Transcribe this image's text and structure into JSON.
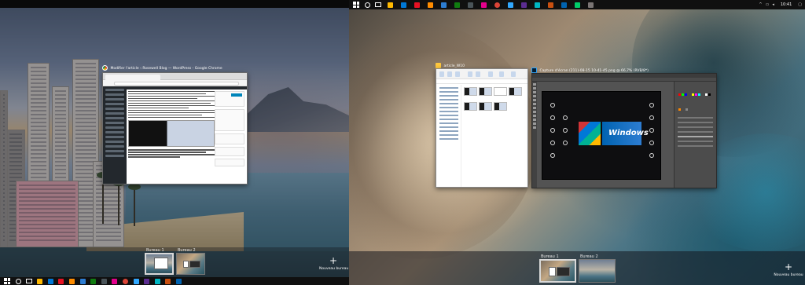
{
  "left_monitor": {
    "window": {
      "title": "Modifier l'article ‹ Rosewell Blog — WordPress - Google Chrome"
    },
    "task_view": {
      "desktops": [
        {
          "label": "Bureau 1",
          "active": true
        },
        {
          "label": "Bureau 2",
          "active": false
        }
      ],
      "new_desktop_label": "Nouveau bureau"
    }
  },
  "right_monitor": {
    "windows": [
      {
        "title": "article_W10",
        "icon": "folder-icon"
      },
      {
        "title": "Capture d'écran (211)-08-15 10-41-45.png @ 66,7% (RVB/8*)",
        "icon": "photoshop-icon"
      }
    ],
    "task_view": {
      "desktops": [
        {
          "label": "Bureau 1",
          "active": true
        },
        {
          "label": "Bureau 2",
          "active": false
        }
      ],
      "new_desktop_label": "Nouveau bureau"
    },
    "taskbar": {
      "time": "10:41"
    },
    "canvas_logo": "Windows"
  },
  "taskbar_icon_colors": [
    "#2d7dd2",
    "#ffb900",
    "#0078d7",
    "#e81123",
    "#ff8c00",
    "#107c10",
    "#5c2d91",
    "#00b7c3",
    "#d83b01",
    "#ffd700",
    "#0063b1",
    "#e3008c",
    "#7a7574",
    "#00cc6a",
    "#ca5010",
    "#4a5459"
  ],
  "accent": "#0078d7"
}
